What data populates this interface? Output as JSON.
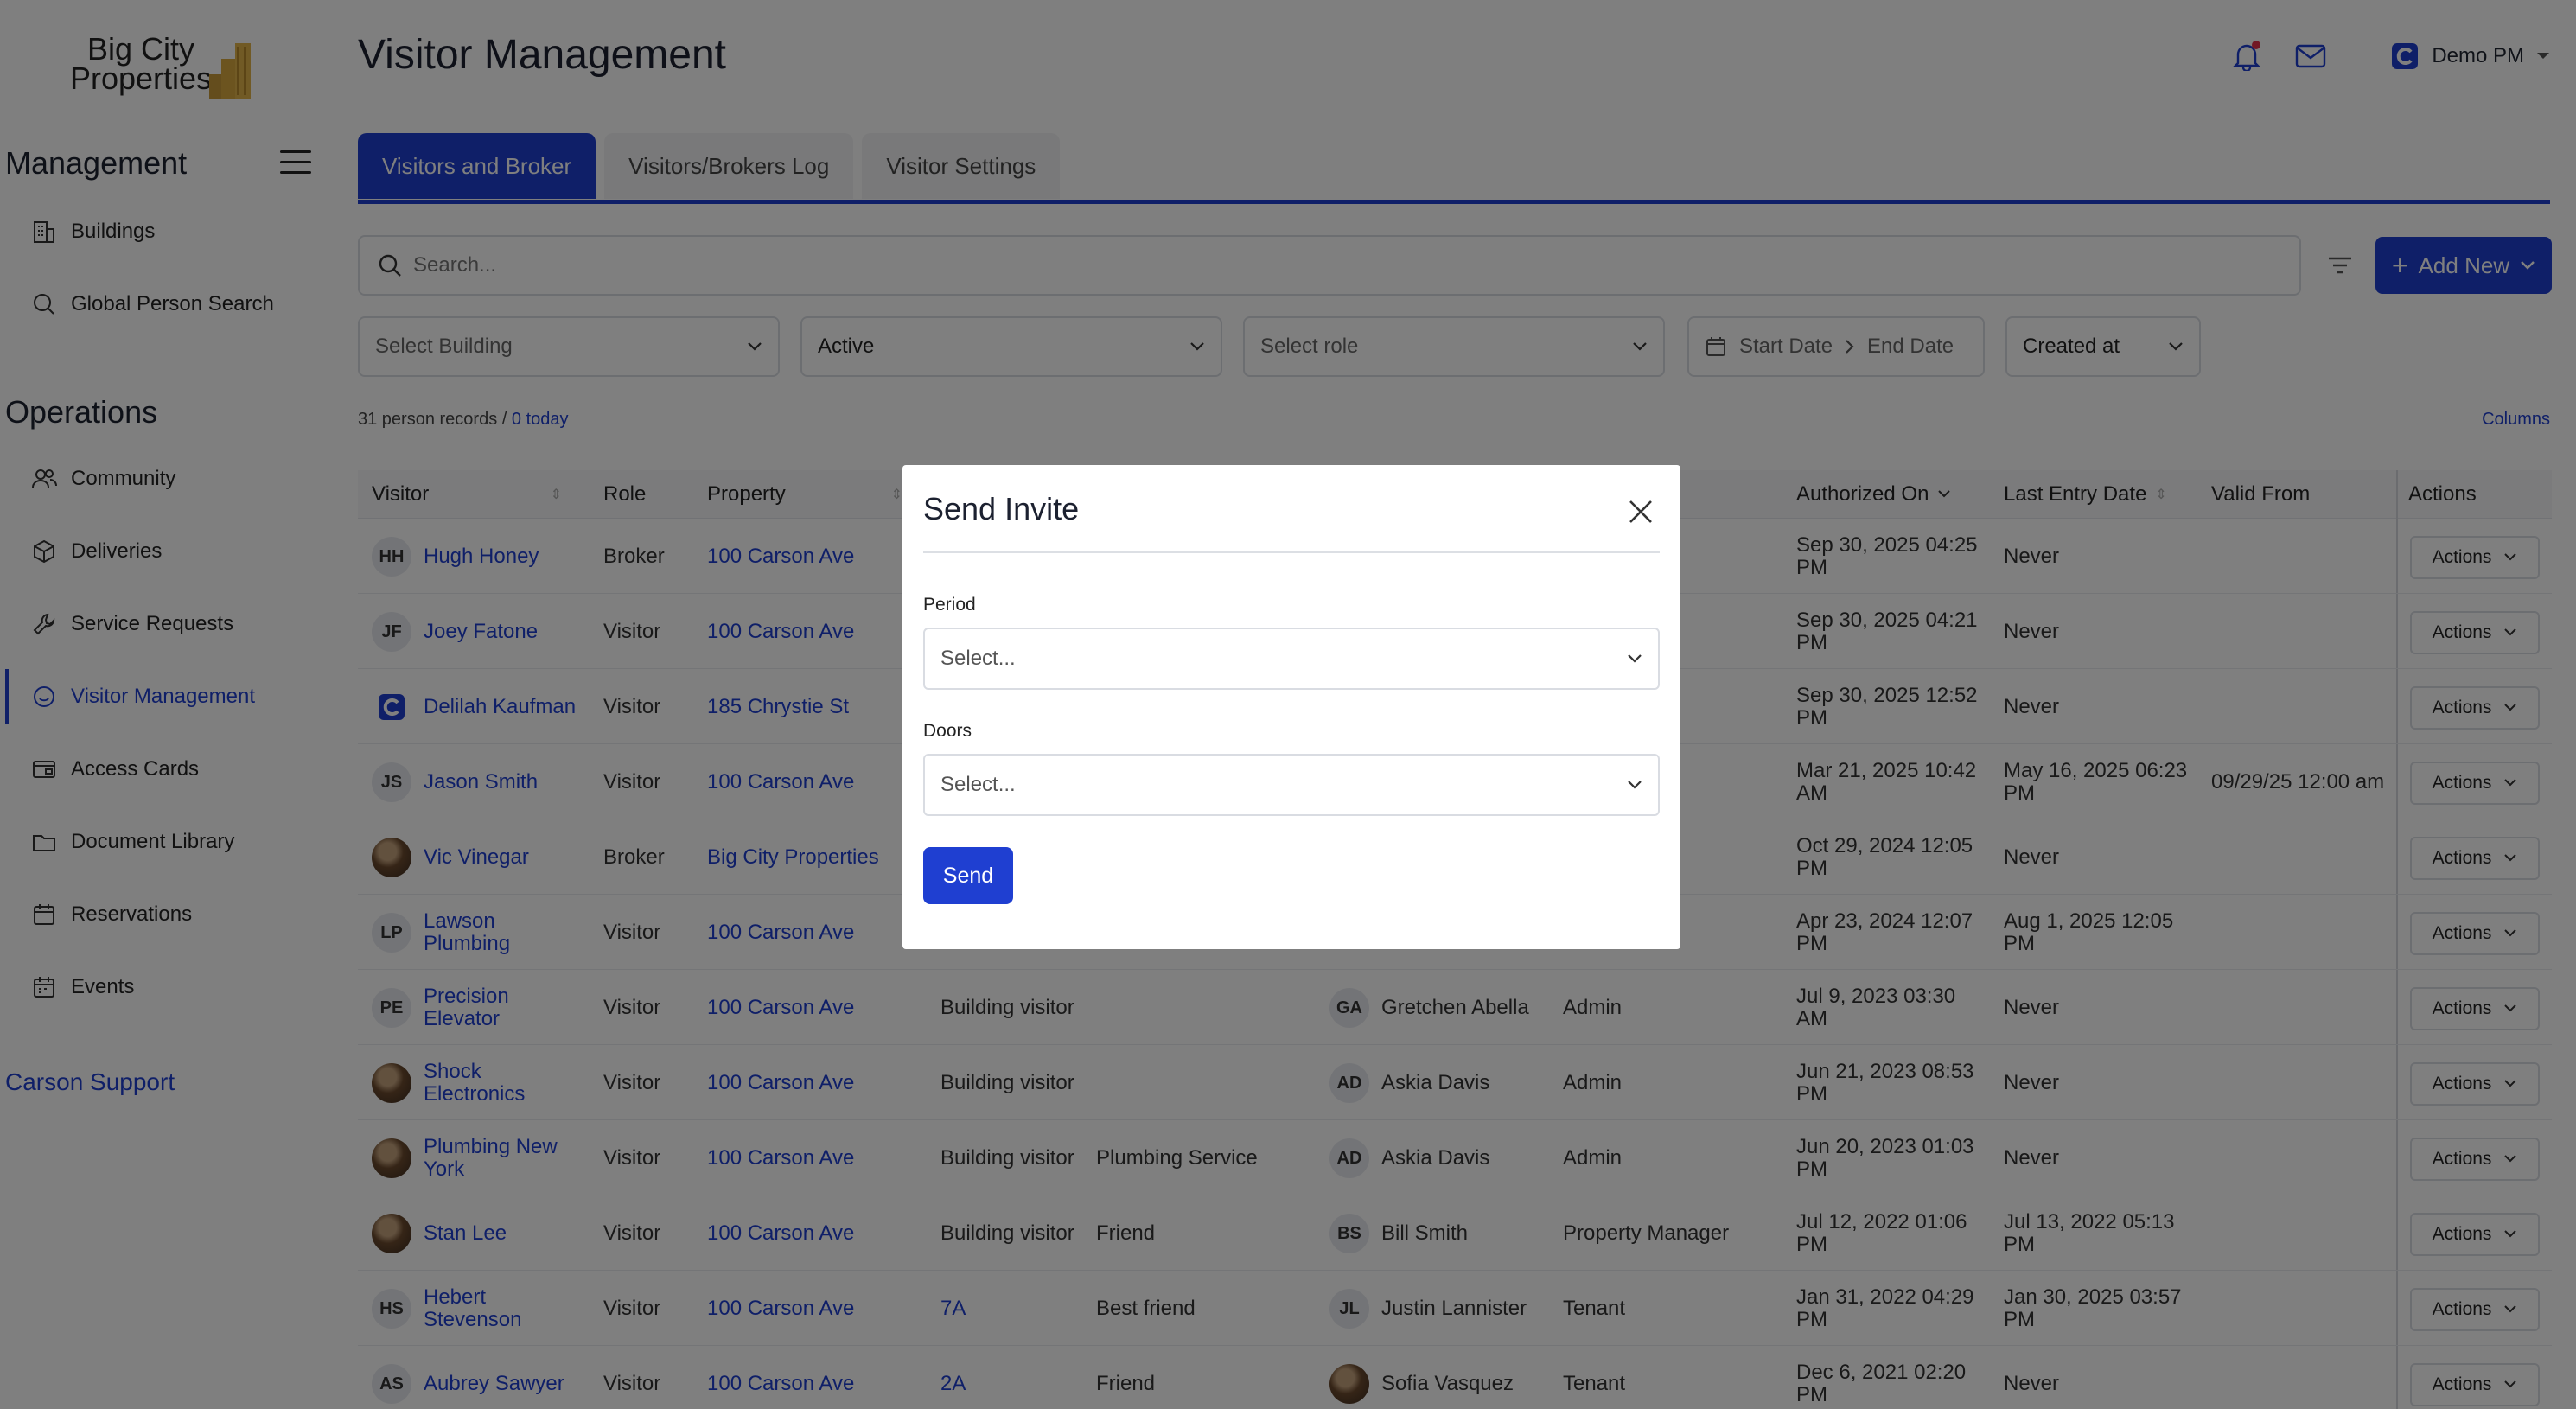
{
  "brand": {
    "logo_text": "Big City Properties",
    "accent": "#1f3fd1"
  },
  "sidebar": {
    "management_title": "Management",
    "management_items": [
      {
        "label": "Buildings",
        "icon": "building-icon"
      },
      {
        "label": "Global Person Search",
        "icon": "search-icon"
      }
    ],
    "operations_title": "Operations",
    "operations_items": [
      {
        "label": "Community",
        "icon": "people-icon"
      },
      {
        "label": "Deliveries",
        "icon": "package-icon"
      },
      {
        "label": "Service Requests",
        "icon": "wrench-icon"
      },
      {
        "label": "Visitor Management",
        "icon": "smiley-icon",
        "active": true
      },
      {
        "label": "Access Cards",
        "icon": "card-icon"
      },
      {
        "label": "Document Library",
        "icon": "folder-icon"
      },
      {
        "label": "Reservations",
        "icon": "calendar-icon"
      },
      {
        "label": "Events",
        "icon": "calendar-grid-icon"
      }
    ],
    "support_label": "Carson Support"
  },
  "header": {
    "title": "Visitor Management",
    "user_name": "Demo PM"
  },
  "tabs": [
    {
      "label": "Visitors and Broker",
      "active": true
    },
    {
      "label": "Visitors/Brokers Log"
    },
    {
      "label": "Visitor Settings"
    }
  ],
  "search": {
    "placeholder": "Search..."
  },
  "add_new_label": "Add New",
  "filters": {
    "building": "Select Building",
    "status": "Active",
    "role": "Select role",
    "start_date": "Start Date",
    "end_date": "End Date",
    "sort": "Created at"
  },
  "records": {
    "count_text": "31 person records /",
    "today_text": "0 today"
  },
  "columns_link": "Columns",
  "table": {
    "headers": {
      "visitor": "Visitor",
      "role": "Role",
      "property": "Property",
      "authorized_on": "Authorized On",
      "last_entry": "Last Entry Date",
      "valid_from": "Valid From",
      "actions": "Actions"
    },
    "action_label": "Actions",
    "rows": [
      {
        "initials": "HH",
        "name": "Hugh Honey",
        "role": "Broker",
        "property": "100 Carson Ave",
        "unit": "",
        "type": "",
        "reason": "",
        "auth_initials": "",
        "auth_name": "",
        "auth_role": "ager",
        "authorized_on": "Sep 30, 2025 04:25 PM",
        "last_entry": "Never",
        "valid_from": ""
      },
      {
        "initials": "JF",
        "name": "Joey Fatone",
        "role": "Visitor",
        "property": "100 Carson Ave",
        "unit": "",
        "type": "",
        "reason": "",
        "auth_initials": "",
        "auth_name": "",
        "auth_role": "ager",
        "authorized_on": "Sep 30, 2025 04:21 PM",
        "last_entry": "Never",
        "valid_from": ""
      },
      {
        "initials": "C",
        "name": "Delilah Kaufman",
        "role": "Visitor",
        "property": "185 Chrystie St",
        "unit": "",
        "type": "",
        "reason": "",
        "auth_initials": "",
        "auth_name": "",
        "auth_role": "ager",
        "authorized_on": "Sep 30, 2025 12:52 PM",
        "last_entry": "Never",
        "valid_from": ""
      },
      {
        "initials": "JS",
        "name": "Jason Smith",
        "role": "Visitor",
        "property": "100 Carson Ave",
        "unit": "",
        "type": "",
        "reason": "",
        "auth_initials": "",
        "auth_name": "",
        "auth_role": "ager",
        "authorized_on": "Mar 21, 2025 10:42 AM",
        "last_entry": "May 16, 2025 06:23 PM",
        "valid_from": "09/29/25 12:00 am"
      },
      {
        "initials": "",
        "name": "Vic Vinegar",
        "role": "Broker",
        "property": "Big City Properties",
        "unit": "",
        "type": "",
        "reason": "",
        "auth_initials": "",
        "auth_name": "",
        "auth_role": "ager",
        "authorized_on": "Oct 29, 2024 12:05 PM",
        "last_entry": "Never",
        "valid_from": ""
      },
      {
        "initials": "LP",
        "name": "Lawson Plumbing",
        "role": "Visitor",
        "property": "100 Carson Ave",
        "unit": "",
        "type": "",
        "reason": "",
        "auth_initials": "",
        "auth_name": "",
        "auth_role": "",
        "authorized_on": "Apr 23, 2024 12:07 PM",
        "last_entry": "Aug 1, 2025 12:05 PM",
        "valid_from": ""
      },
      {
        "initials": "PE",
        "name": "Precision Elevator",
        "role": "Visitor",
        "property": "100 Carson Ave",
        "unit": "",
        "type": "Building visitor",
        "reason": "",
        "auth_initials": "GA",
        "auth_name": "Gretchen Abella",
        "auth_role": "Admin",
        "authorized_on": "Jul 9, 2023 03:30 AM",
        "last_entry": "Never",
        "valid_from": ""
      },
      {
        "initials": "",
        "name": "Shock Electronics",
        "role": "Visitor",
        "property": "100 Carson Ave",
        "unit": "",
        "type": "Building visitor",
        "reason": "",
        "auth_initials": "AD",
        "auth_name": "Askia Davis",
        "auth_role": "Admin",
        "authorized_on": "Jun 21, 2023 08:53 PM",
        "last_entry": "Never",
        "valid_from": ""
      },
      {
        "initials": "",
        "name": "Plumbing New York",
        "role": "Visitor",
        "property": "100 Carson Ave",
        "unit": "",
        "type": "Building visitor",
        "reason": "Plumbing Service",
        "auth_initials": "AD",
        "auth_name": "Askia Davis",
        "auth_role": "Admin",
        "authorized_on": "Jun 20, 2023 01:03 PM",
        "last_entry": "Never",
        "valid_from": ""
      },
      {
        "initials": "",
        "name": "Stan Lee",
        "role": "Visitor",
        "property": "100 Carson Ave",
        "unit": "",
        "type": "Building visitor",
        "reason": "Friend",
        "auth_initials": "BS",
        "auth_name": "Bill Smith",
        "auth_role": "Property Manager",
        "authorized_on": "Jul 12, 2022 01:06 PM",
        "last_entry": "Jul 13, 2022 05:13 PM",
        "valid_from": ""
      },
      {
        "initials": "HS",
        "name": "Hebert Stevenson",
        "role": "Visitor",
        "property": "100 Carson Ave",
        "unit": "7A",
        "type": "",
        "reason": "Best friend",
        "auth_initials": "JL",
        "auth_name": "Justin Lannister",
        "auth_role": "Tenant",
        "authorized_on": "Jan 31, 2022 04:29 PM",
        "last_entry": "Jan 30, 2025 03:57 PM",
        "valid_from": ""
      },
      {
        "initials": "AS",
        "name": "Aubrey Sawyer",
        "role": "Visitor",
        "property": "100 Carson Ave",
        "unit": "2A",
        "type": "",
        "reason": "Friend",
        "auth_initials": "",
        "auth_name": "Sofia Vasquez",
        "auth_role": "Tenant",
        "authorized_on": "Dec 6, 2021 02:20 PM",
        "last_entry": "Never",
        "valid_from": ""
      }
    ]
  },
  "modal": {
    "title": "Send Invite",
    "period_label": "Period",
    "period_placeholder": "Select...",
    "doors_label": "Doors",
    "doors_placeholder": "Select...",
    "send_label": "Send"
  }
}
